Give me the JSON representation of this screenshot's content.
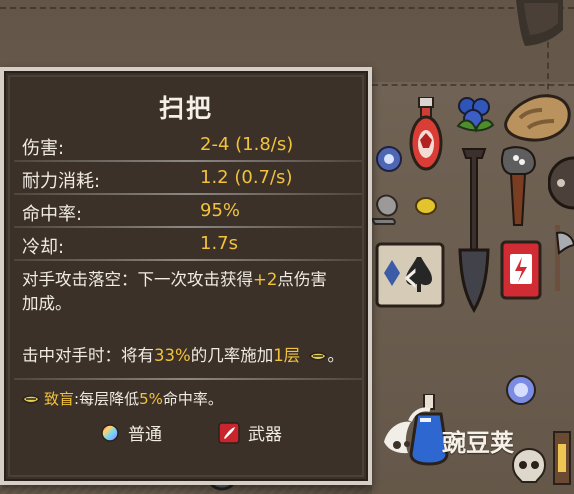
{
  "tooltip": {
    "title": "扫把",
    "stats": [
      {
        "label": "伤害:",
        "value": "2-4 (1.8/s)"
      },
      {
        "label": "耐力消耗:",
        "value": "1.2 (0.7/s)"
      },
      {
        "label": "命中率:",
        "value": "95%"
      },
      {
        "label": "冷却:",
        "value": "1.7s"
      }
    ],
    "effect1": {
      "prefix": "对手攻击落空：下一次攻击获得",
      "highlight": "+2",
      "suffix_line1": "点伤害",
      "line2": "加成。"
    },
    "effect2": {
      "prefix": "击中对手时：将有",
      "highlight1": "33%",
      "middle": "的几率施加",
      "highlight2": "1层",
      "suffix": "。"
    },
    "status": {
      "name": "致盲",
      "separator": ":",
      "desc_prefix": "每层降低",
      "desc_highlight": "5%",
      "desc_suffix": "命中率。"
    },
    "rarity": {
      "label": "普通",
      "icon": "rainbow-orb-icon"
    },
    "type": {
      "label": "武器",
      "icon": "weapon-slash-icon"
    }
  },
  "inventory": {
    "nav_arrow": "‹",
    "items": [
      "red-potion-icon",
      "blueberries-icon",
      "bread-icon",
      "blue-gem-icon",
      "shovel-icon",
      "torch-icon",
      "shield-icon",
      "snail-icon",
      "card-icon",
      "red-card-icon",
      "orb-icon",
      "skull-icon",
      "blue-potion-icon",
      "lantern-icon",
      "axe-icon"
    ]
  },
  "watermark": "豌豆荚",
  "colors": {
    "gold": "#f2c23c",
    "text": "#f0ebe3",
    "panel": "#3b3129",
    "border": "#d5cfc7"
  }
}
